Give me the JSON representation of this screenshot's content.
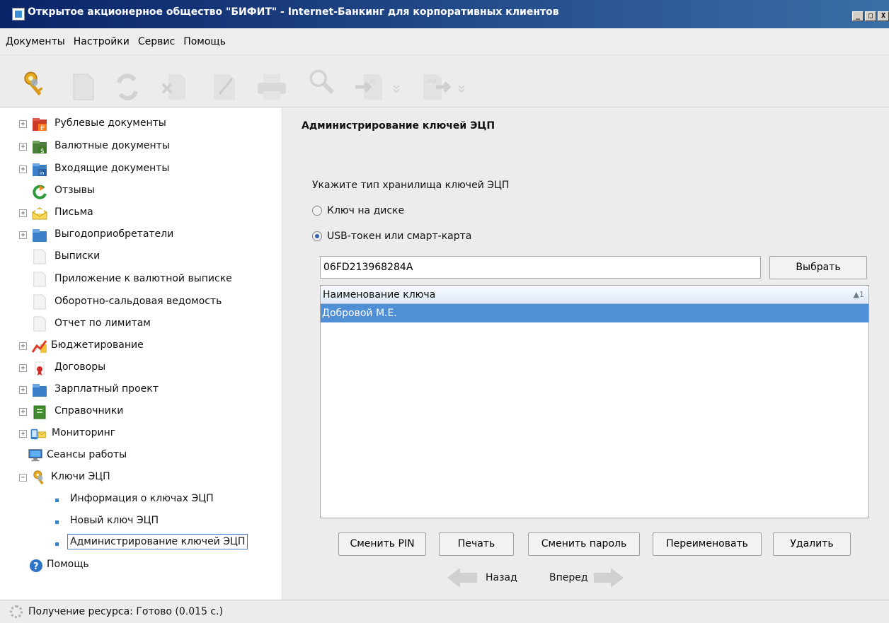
{
  "window": {
    "title": "Открытое акционерное общество \"БИФИТ\" - Internet-Банкинг для корпоративных клиентов",
    "controls": [
      "_",
      "□",
      "X"
    ]
  },
  "menu": [
    "Документы",
    "Настройки",
    "Сервис",
    "Помощь"
  ],
  "toolbar": {
    "icons": [
      "keys-icon",
      "document-icon",
      "refresh-icon",
      "delete-icon",
      "edit-icon",
      "print-icon",
      "search-icon",
      "import-icon",
      "export-icon"
    ],
    "import_label": "in",
    "export_label": "out"
  },
  "tree": {
    "items": [
      {
        "label": "Рублевые документы",
        "icon": "ruble-folder-icon"
      },
      {
        "label": "Валютные документы",
        "icon": "currency-folder-icon"
      },
      {
        "label": "Входящие документы",
        "icon": "incoming-folder-icon"
      },
      {
        "label": "Отзывы",
        "icon": "revoke-icon"
      },
      {
        "label": "Письма",
        "icon": "letter-icon"
      },
      {
        "label": "Выгодоприобретатели",
        "icon": "folder-icon"
      },
      {
        "label": "Выписки",
        "icon": "document-icon"
      },
      {
        "label": "Приложение к валютной выписке",
        "icon": "document-icon"
      },
      {
        "label": "Оборотно-сальдовая ведомость",
        "icon": "document-icon"
      },
      {
        "label": "Отчет по лимитам",
        "icon": "document-icon"
      },
      {
        "label": "Бюджетирование",
        "icon": "budget-chart-icon"
      },
      {
        "label": "Договоры",
        "icon": "contract-icon"
      },
      {
        "label": "Зарплатный проект",
        "icon": "folder-icon"
      },
      {
        "label": "Справочники",
        "icon": "book-icon"
      },
      {
        "label": "Мониторинг",
        "icon": "monitoring-icon"
      },
      {
        "label": "Сеансы работы",
        "icon": "monitor-icon"
      },
      {
        "label": "Ключи ЭЦП",
        "icon": "keys-icon"
      },
      {
        "label": "Информация о ключах ЭЦП",
        "icon": "bullet-icon"
      },
      {
        "label": "Новый ключ ЭЦП",
        "icon": "bullet-icon"
      },
      {
        "label": "Администрирование ключей ЭЦП",
        "icon": "bullet-icon"
      },
      {
        "label": "Помощь",
        "icon": "help-icon"
      }
    ]
  },
  "status": {
    "text": "Получение ресурса: Готово (0.015 с.)"
  },
  "content": {
    "title": "Администрирование ключей ЭЦП",
    "storage_prompt": "Укажите тип хранилища ключей ЭЦП",
    "options": [
      {
        "label": "Ключ на диске",
        "checked": false
      },
      {
        "label": "USB-токен или смарт-карта",
        "checked": true
      }
    ],
    "token_value": "06FD213968284A",
    "choose_button": "Выбрать",
    "table": {
      "header": "Наименование ключа",
      "sort_indicator": "▲1",
      "rows": [
        "Добровой М.Е."
      ]
    },
    "actions": [
      "Сменить PIN",
      "Печать",
      "Сменить пароль",
      "Переименовать",
      "Удалить"
    ],
    "back": "Назад",
    "forward": "Вперед"
  },
  "colors": {
    "titlebar": "#0a246a",
    "selection": "#4f8fd6",
    "panel": "#ececec"
  }
}
